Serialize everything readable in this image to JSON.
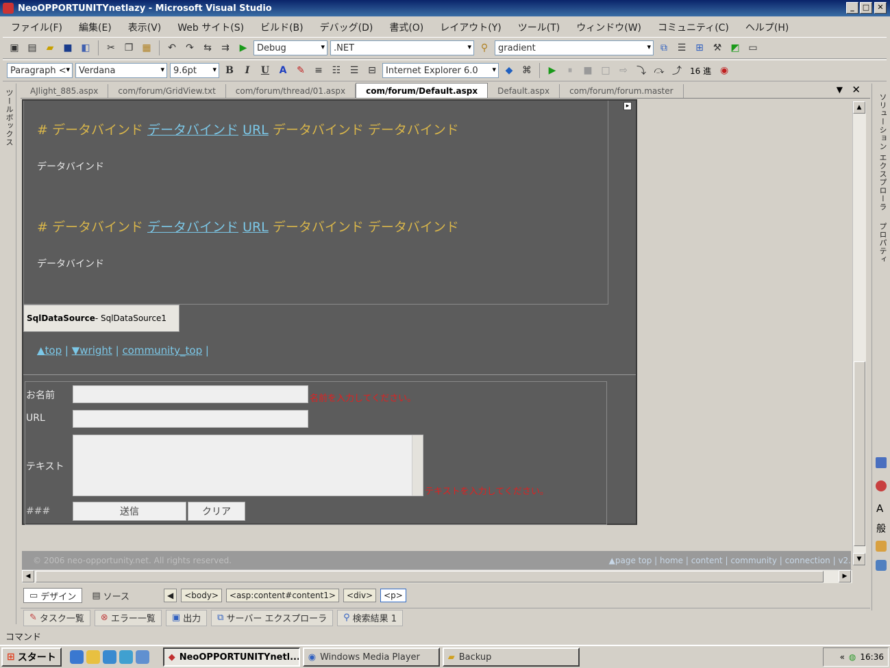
{
  "window": {
    "title": "NeoOPPORTUNITYnetlazy - Microsoft Visual Studio",
    "controls": [
      "_",
      "□",
      "✕"
    ]
  },
  "menu": [
    "ファイル(F)",
    "編集(E)",
    "表示(V)",
    "Web サイト(S)",
    "ビルド(B)",
    "デバッグ(D)",
    "書式(O)",
    "レイアウト(Y)",
    "ツール(T)",
    "ウィンドウ(W)",
    "コミュニティ(C)",
    "ヘルプ(H)"
  ],
  "toolbar1": {
    "config": "Debug",
    "platform": ".NET",
    "find": "gradient"
  },
  "toolbar2": {
    "block_format": "Paragraph <",
    "font": "Verdana",
    "size": "9.6pt",
    "browser": "Internet Explorer 6.0",
    "zoom_label": "16 進"
  },
  "tabs": [
    {
      "label": "AJlight_885.aspx"
    },
    {
      "label": "com/forum/GridView.txt"
    },
    {
      "label": "com/forum/thread/01.aspx"
    },
    {
      "label": "com/forum/Default.aspx",
      "active": true
    },
    {
      "label": "Default.aspx"
    },
    {
      "label": "com/forum/forum.master"
    }
  ],
  "left_strip": {
    "label": "ツールボックス"
  },
  "right_strip": {
    "solution": "ソリューション エクスプローラ",
    "properties": "プロパティ"
  },
  "design": {
    "headline_prefix": "# データバインド",
    "headline_link1": "データバインド",
    "headline_link2": "URL",
    "headline_suffix": "データバインド データバインド",
    "body": "データバインド",
    "sqlsource_bold": "SqlDataSource",
    "sqlsource_name": " - SqlDataSource1",
    "nav": {
      "top": "▲top",
      "sep1": "|",
      "wright": "▼wright",
      "sep2": "|",
      "community": "community_top",
      "sep3": "|"
    },
    "form": {
      "name_label": "お名前",
      "url_label": "URL",
      "text_label": "テキスト",
      "hash_label": "###",
      "name_error": "名前を入力してください。",
      "text_error": "テキストを入力してください。",
      "submit": "送信",
      "clear": "クリア"
    },
    "footer_copy": "© 2006 neo-opportunity.net. All rights reserved.",
    "footer_links": "▲page top | home | content | community | connection | v2."
  },
  "view_tabs": {
    "design": "デザイン",
    "source": "ソース"
  },
  "breadcrumbs": [
    "<body>",
    "<asp:content#content1>",
    "<div>",
    "<p>"
  ],
  "panels": [
    "タスク一覧",
    "エラー一覧",
    "出力",
    "サーバー エクスプローラ",
    "検索結果 1"
  ],
  "status": "コマンド",
  "taskbar": {
    "start": "スタート",
    "tasks": [
      {
        "label": "NeoOPPORTUNITYnetl...",
        "active": true
      },
      {
        "label": "Windows Media Player"
      },
      {
        "label": "Backup"
      }
    ],
    "clock": "16:36"
  }
}
